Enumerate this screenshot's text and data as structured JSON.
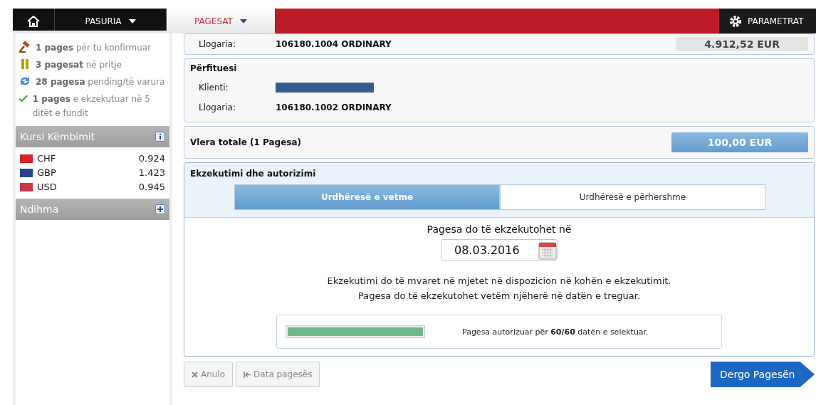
{
  "nav": {
    "items": [
      {
        "kind": "home",
        "selected": false
      },
      {
        "kind": "menu",
        "label": "PASURIA",
        "selected": false
      },
      {
        "kind": "menu",
        "label": "PAGESAT",
        "selected": true
      }
    ],
    "settings": "PARAMETRAT"
  },
  "sidebar": {
    "summary": [
      {
        "kind": "gavel",
        "text": "**1 pages** për tu konfirmuar"
      },
      {
        "kind": "pause",
        "text": "**3 pagesat** në pritje"
      },
      {
        "kind": "refresh",
        "text": "**28 pagesa** pending/të varura"
      },
      {
        "kind": "check",
        "text": "**1 pages** e ekzekutuar në 5 ditët e fundit"
      }
    ],
    "rates_title": "Kursi Këmbimit",
    "rates": [
      {
        "currency": "CHF",
        "value": "0.924",
        "color": "#d9222a"
      },
      {
        "currency": "GBP",
        "value": "1.423",
        "color": "#2a3f8f"
      },
      {
        "currency": "USD",
        "value": "0.945",
        "color": "#c8374a"
      }
    ],
    "help_title": "Ndihma"
  },
  "sender": {
    "label": "Llogaria:",
    "value": "106180.1004 ORDINARY",
    "balance": "4.912,52 EUR"
  },
  "beneficiary": {
    "title": "Përfituesi",
    "rows": [
      {
        "label": "Klienti:",
        "redacted": true
      },
      {
        "label": "Llogaria:",
        "value": "106180.1002 ORDINARY",
        "redacted": false
      }
    ]
  },
  "total": {
    "label": "Vlera totale (1 Pagesa)",
    "amount": "100,00 EUR"
  },
  "execution": {
    "title": "Ekzekutimi dhe autorizimi",
    "tabs": [
      {
        "label": "Urdhëresë e vetme",
        "selected": true
      },
      {
        "label": "Urdhëresë e përhershme",
        "selected": false
      }
    ],
    "date_label": "Pagesa do të ekzekutohet në",
    "date": "08.03.2016",
    "notes": [
      "Ekzekutimi do të mvaret në mjetet në dispozicion në kohën e ekzekutimit.",
      "Pagesa do të ekzekutohet vetëm njëherë në datën e treguar."
    ],
    "authorization": {
      "level": 1,
      "text": "Pagesa autorizuar për **60/60** datën e selektuar."
    }
  },
  "buttons": [
    {
      "kind": "cancel",
      "label": "Anulo"
    },
    {
      "kind": "back",
      "label": "Data pagesës"
    },
    {
      "kind": "submit",
      "label": "Dergo Pagesën"
    }
  ]
}
